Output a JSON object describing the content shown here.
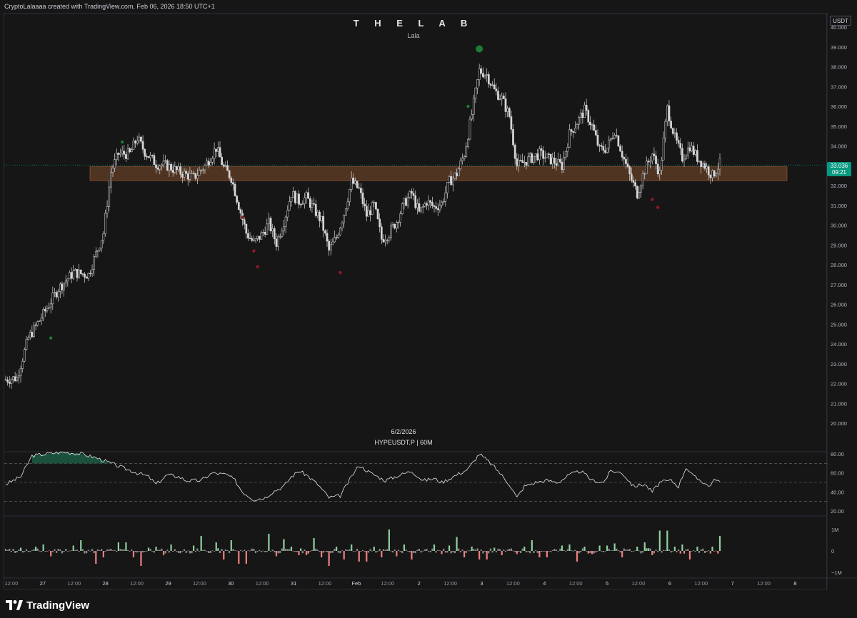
{
  "header": {
    "attribution": "CryptoLalaaaa created with TradingView.com, Feb 06, 2026 18:50 UTC+1"
  },
  "chart_title": "T H E L A B",
  "chart_subtitle": "Lala",
  "watermark": {
    "date": "6/2/2026",
    "symbol": "HYPEUSDT.P | 60M"
  },
  "price_axis": {
    "currency": "USDT",
    "current_price": "33.036",
    "countdown": "09:21"
  },
  "footer": {
    "brand": "TradingView"
  },
  "colors": {
    "background": "#161616",
    "candle": "#d6d6d6",
    "zone": "#5a3a24",
    "zone_border": "#a8643a",
    "last_price": "#089981",
    "signal_buy": "#1f7a35",
    "signal_sell": "#8e1b2a",
    "rsi_line": "#e6e6e6",
    "rsi_fill": "#1e6b4d",
    "vol_up": "#8fd19e",
    "vol_down": "#f08080",
    "vol_neutral": "#8a8a8a"
  },
  "chart_data": [
    {
      "type": "candlestick",
      "symbol": "HYPEUSDT.P",
      "timeframe": "60M",
      "y_axis": {
        "min": 19.5,
        "max": 40.2,
        "ticks": [
          "40.000",
          "39.000",
          "38.000",
          "37.000",
          "36.000",
          "35.000",
          "34.000",
          "33.000",
          "32.000",
          "31.000",
          "30.000",
          "29.000",
          "28.000",
          "27.000",
          "26.000",
          "25.000",
          "24.000",
          "23.000",
          "22.000",
          "21.000",
          "20.000"
        ]
      },
      "x_axis": {
        "tick_labels": [
          "12:00",
          "27",
          "12:00",
          "28",
          "12:00",
          "29",
          "12:00",
          "30",
          "12:00",
          "31",
          "12:00",
          "Feb",
          "12:00",
          "2",
          "12:00",
          "3",
          "12:00",
          "4",
          "12:00",
          "5",
          "12:00",
          "6",
          "12:00",
          "7",
          "12:00",
          "8"
        ]
      },
      "path": [
        [
          0,
          22.2
        ],
        [
          6,
          22.3
        ],
        [
          12,
          24.3
        ],
        [
          20,
          25.5
        ],
        [
          28,
          26.8
        ],
        [
          36,
          27.6
        ],
        [
          44,
          27.5
        ],
        [
          52,
          29.6
        ],
        [
          56,
          32.7
        ],
        [
          60,
          33.6
        ],
        [
          66,
          33.6
        ],
        [
          70,
          34.4
        ],
        [
          74,
          33.7
        ],
        [
          80,
          33.1
        ],
        [
          86,
          33.0
        ],
        [
          92,
          32.7
        ],
        [
          100,
          32.4
        ],
        [
          106,
          33.0
        ],
        [
          112,
          33.9
        ],
        [
          116,
          32.9
        ],
        [
          120,
          32.4
        ],
        [
          124,
          31.0
        ],
        [
          128,
          29.6
        ],
        [
          132,
          29.1
        ],
        [
          136,
          29.5
        ],
        [
          140,
          30.1
        ],
        [
          144,
          29.1
        ],
        [
          148,
          30.2
        ],
        [
          152,
          31.6
        ],
        [
          156,
          31.2
        ],
        [
          160,
          31.4
        ],
        [
          164,
          30.8
        ],
        [
          168,
          30.2
        ],
        [
          172,
          28.7
        ],
        [
          176,
          29.4
        ],
        [
          180,
          30.6
        ],
        [
          184,
          32.2
        ],
        [
          188,
          31.8
        ],
        [
          192,
          30.5
        ],
        [
          196,
          31.0
        ],
        [
          200,
          29.3
        ],
        [
          204,
          29.6
        ],
        [
          208,
          30.2
        ],
        [
          212,
          31.1
        ],
        [
          216,
          31.6
        ],
        [
          220,
          30.6
        ],
        [
          224,
          31.2
        ],
        [
          228,
          30.9
        ],
        [
          232,
          31.1
        ],
        [
          236,
          32.2
        ],
        [
          240,
          32.6
        ],
        [
          244,
          33.6
        ],
        [
          248,
          35.6
        ],
        [
          252,
          37.8
        ],
        [
          256,
          37.6
        ],
        [
          260,
          36.8
        ],
        [
          264,
          36.4
        ],
        [
          268,
          35.5
        ],
        [
          272,
          33.0
        ],
        [
          276,
          33.2
        ],
        [
          280,
          33.4
        ],
        [
          284,
          33.6
        ],
        [
          288,
          33.4
        ],
        [
          292,
          33.2
        ],
        [
          296,
          33.0
        ],
        [
          300,
          34.6
        ],
        [
          304,
          35.2
        ],
        [
          308,
          35.8
        ],
        [
          312,
          35.0
        ],
        [
          316,
          33.8
        ],
        [
          320,
          33.9
        ],
        [
          324,
          34.8
        ],
        [
          328,
          33.6
        ],
        [
          332,
          32.5
        ],
        [
          336,
          31.6
        ],
        [
          340,
          32.8
        ],
        [
          344,
          33.6
        ],
        [
          348,
          32.6
        ],
        [
          352,
          35.9
        ],
        [
          356,
          34.4
        ],
        [
          360,
          33.4
        ],
        [
          364,
          34.0
        ],
        [
          368,
          33.4
        ],
        [
          372,
          33.0
        ],
        [
          376,
          32.5
        ],
        [
          380,
          33.1
        ]
      ],
      "last_price": 33.036,
      "support_zone": [
        32.25,
        32.95
      ],
      "signals_buy": [
        [
          24,
          24.3
        ],
        [
          62,
          34.2
        ],
        [
          246,
          36.0
        ],
        [
          252,
          38.9
        ]
      ],
      "signals_sell": [
        [
          126,
          30.4
        ],
        [
          132,
          28.7
        ],
        [
          134,
          27.9
        ],
        [
          178,
          27.6
        ],
        [
          344,
          31.3
        ],
        [
          347,
          30.9
        ]
      ]
    },
    {
      "type": "line",
      "name": "RSI",
      "y_ticks": [
        "80.00",
        "60.00",
        "40.00",
        "20.00"
      ],
      "levels": [
        70,
        50,
        30
      ],
      "path": [
        [
          0,
          48
        ],
        [
          8,
          56
        ],
        [
          14,
          78
        ],
        [
          22,
          80
        ],
        [
          30,
          82
        ],
        [
          40,
          80
        ],
        [
          48,
          76
        ],
        [
          56,
          70
        ],
        [
          64,
          64
        ],
        [
          70,
          60
        ],
        [
          76,
          56
        ],
        [
          80,
          48
        ],
        [
          86,
          58
        ],
        [
          92,
          56
        ],
        [
          96,
          52
        ],
        [
          104,
          52
        ],
        [
          110,
          60
        ],
        [
          118,
          58
        ],
        [
          122,
          52
        ],
        [
          126,
          40
        ],
        [
          132,
          32
        ],
        [
          138,
          34
        ],
        [
          142,
          40
        ],
        [
          148,
          46
        ],
        [
          152,
          56
        ],
        [
          156,
          62
        ],
        [
          160,
          58
        ],
        [
          166,
          48
        ],
        [
          172,
          34
        ],
        [
          178,
          36
        ],
        [
          184,
          56
        ],
        [
          188,
          68
        ],
        [
          194,
          60
        ],
        [
          198,
          56
        ],
        [
          202,
          52
        ],
        [
          210,
          58
        ],
        [
          216,
          62
        ],
        [
          222,
          52
        ],
        [
          228,
          54
        ],
        [
          232,
          50
        ],
        [
          240,
          58
        ],
        [
          246,
          64
        ],
        [
          252,
          80
        ],
        [
          258,
          70
        ],
        [
          262,
          62
        ],
        [
          268,
          48
        ],
        [
          272,
          34
        ],
        [
          276,
          46
        ],
        [
          282,
          50
        ],
        [
          288,
          52
        ],
        [
          294,
          50
        ],
        [
          300,
          58
        ],
        [
          306,
          62
        ],
        [
          312,
          52
        ],
        [
          318,
          50
        ],
        [
          322,
          62
        ],
        [
          328,
          60
        ],
        [
          334,
          46
        ],
        [
          340,
          48
        ],
        [
          344,
          40
        ],
        [
          348,
          50
        ],
        [
          354,
          52
        ],
        [
          358,
          46
        ],
        [
          362,
          66
        ],
        [
          366,
          56
        ],
        [
          370,
          52
        ],
        [
          374,
          46
        ],
        [
          378,
          54
        ],
        [
          380,
          50
        ]
      ]
    },
    {
      "type": "bar",
      "name": "Volume delta",
      "y_ticks": [
        "1M",
        "0",
        "−1M"
      ],
      "values": [
        0.1,
        0.15,
        -0.05,
        0.2,
        0.3,
        -0.25,
        0.1,
        0.25,
        0.5,
        0.05,
        -0.6,
        -0.3,
        0.1,
        0.4,
        -0.3,
        -0.7,
        0.15,
        0.2,
        -0.2,
        0.3,
        -0.1,
        0.25,
        0.7,
        -0.1,
        0.4,
        -0.4,
        0.5,
        -0.6,
        0.1,
        -0.05,
        0.8,
        -0.25,
        0.55,
        0.2,
        -0.2,
        0.6,
        -0.3,
        -0.7,
        0.2,
        -0.4,
        0.3,
        -0.5,
        0.2,
        -0.3,
        1.0,
        -0.25,
        0.3,
        -0.4,
        0.1,
        0.3,
        -0.15,
        0.25,
        0.65,
        -0.3,
        0.2,
        -0.4,
        0.15,
        -0.2,
        0.1,
        -0.15,
        0.2,
        0.5,
        -0.3,
        0.1,
        0.25,
        0.3,
        -0.5,
        0.2,
        -0.15,
        0.25,
        0.35,
        -0.3,
        0.1,
        0.2,
        0.4,
        -0.2,
        0.95,
        0.2,
        0.3,
        -0.4,
        0.2,
        -0.1,
        0.2,
        0.7
      ]
    }
  ]
}
